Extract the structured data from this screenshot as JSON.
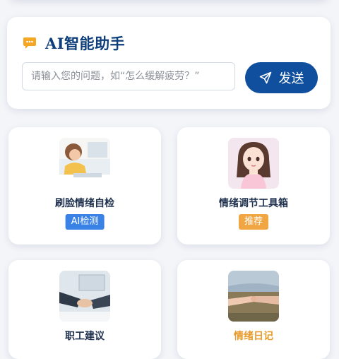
{
  "assistant": {
    "title": "AI智能助手",
    "input_placeholder": "请输入您的问题，如“怎么缓解疲劳？”",
    "send_label": "发送"
  },
  "features": [
    {
      "label": "刷脸情绪自检",
      "tag": "AI检测",
      "tag_color": "#3b82e6"
    },
    {
      "label": "情绪调节工具箱",
      "tag": "推荐",
      "tag_color": "#f0a743"
    },
    {
      "label": "职工建议"
    },
    {
      "label": "情绪日记",
      "label_color": "#e89a2b"
    }
  ],
  "colors": {
    "primary": "#0f4f9e",
    "accent": "#f5a623",
    "title": "#0f3f7a"
  }
}
